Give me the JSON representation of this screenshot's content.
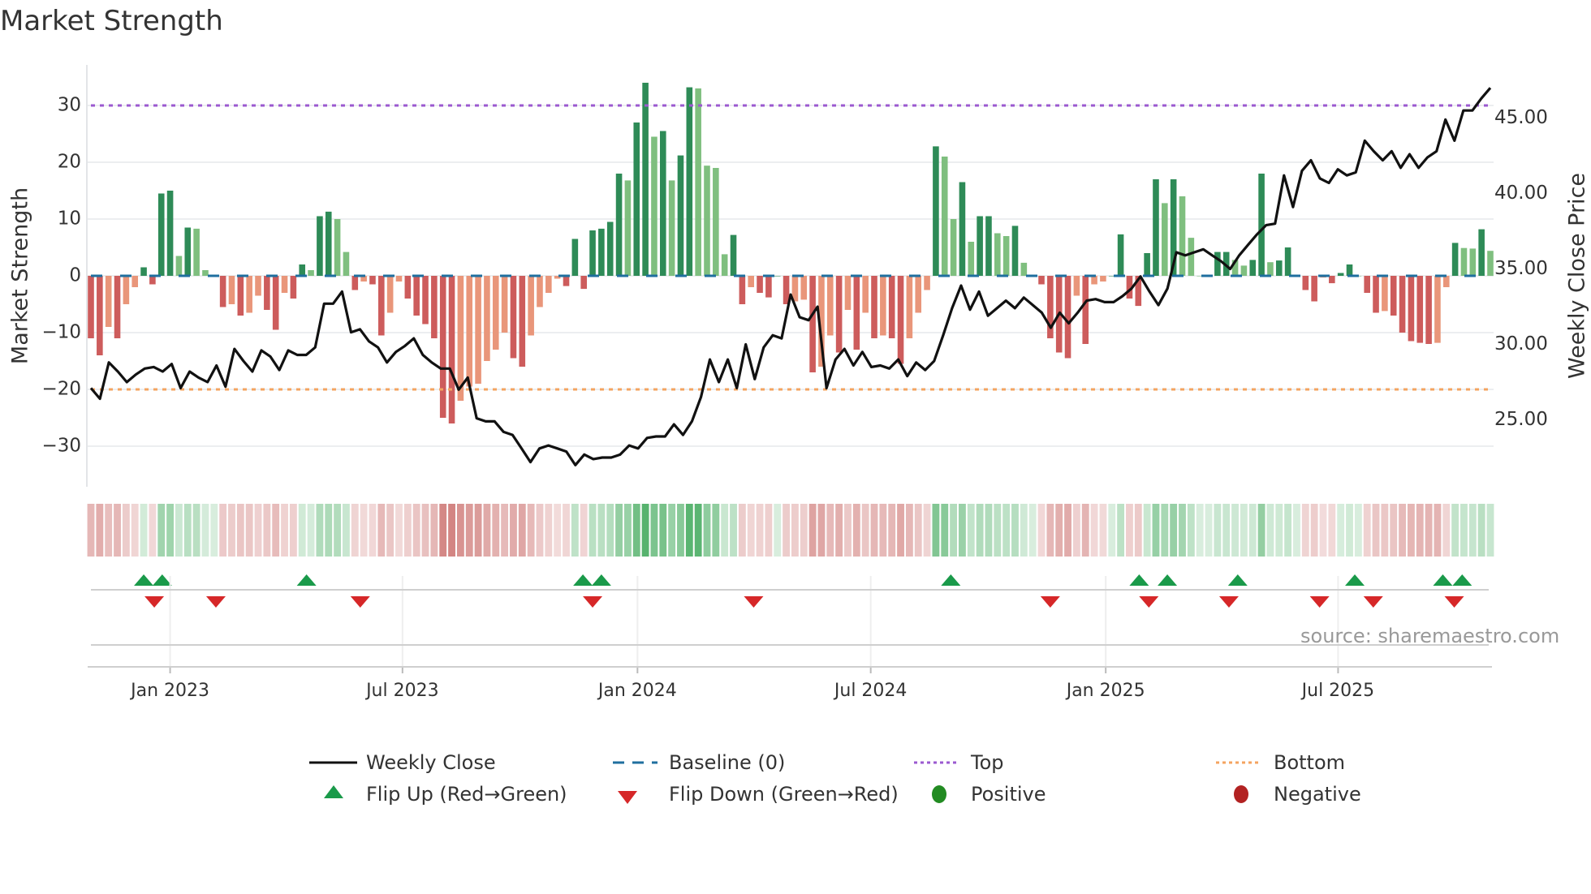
{
  "title": "Market Strength",
  "source": "source: sharemaestro.com",
  "colors": {
    "green_dark": "#2e8b57",
    "green_light": "#7fbf7f",
    "red_dark": "#cd5c5c",
    "red_light": "#e9967a",
    "heat_green": "#3aa655",
    "heat_red": "#c0504d",
    "top": "#9b59d0",
    "bottom": "#f4a460",
    "baseline": "#1f6f9f",
    "line": "#111111",
    "flip_up": "#1a9a4a",
    "flip_down": "#d62728",
    "positive": "#228b22",
    "negative": "#b22222"
  },
  "chart_data": {
    "type": "bar",
    "title": "Market Strength",
    "ylabel": "Market Strength",
    "y2label": "Weekly Close Price",
    "ylim": [
      -37,
      37
    ],
    "y2lim": [
      21,
      48
    ],
    "yticks": [
      30,
      20,
      10,
      0,
      -10,
      -20,
      -30
    ],
    "ytick_labels": [
      "30",
      "20",
      "10",
      "0",
      "−10",
      "−20",
      "−30"
    ],
    "y2ticks": [
      45,
      40,
      35,
      30,
      25
    ],
    "y2tick_labels": [
      "45.00",
      "40.00",
      "35.00",
      "30.00",
      "25.00"
    ],
    "top_level": 30,
    "bottom_level": -20,
    "xticks": [
      {
        "week": 9.0,
        "label": "Jan 2023"
      },
      {
        "week": 35.4,
        "label": "Jul 2023"
      },
      {
        "week": 62.1,
        "label": "Jan 2024"
      },
      {
        "week": 88.6,
        "label": "Jul 2024"
      },
      {
        "week": 115.3,
        "label": "Jan 2025"
      },
      {
        "week": 141.7,
        "label": "Jul 2025"
      }
    ],
    "strength": [
      -11,
      -14,
      -9,
      -11,
      -5,
      -2,
      1.5,
      -1.5,
      14.5,
      15,
      3.5,
      8.5,
      8.3,
      1,
      0,
      -5.5,
      -5,
      -7,
      -6.5,
      -3.5,
      -6,
      -9.5,
      -3,
      -4,
      2,
      1,
      10.5,
      11.3,
      10,
      4.2,
      -2.5,
      -1,
      -1.5,
      -10.5,
      -6.5,
      -1,
      -4,
      -7,
      -8.5,
      -11,
      -25,
      -26,
      -22,
      -19.5,
      -19,
      -15,
      -13,
      -10,
      -14.5,
      -16,
      -10.5,
      -5.5,
      -3,
      -0.5,
      -1.8,
      6.5,
      -2.3,
      8,
      8.3,
      9.5,
      18,
      16.8,
      27,
      34,
      24.5,
      25.5,
      16.8,
      21.2,
      33.2,
      33,
      19.4,
      19,
      3.8,
      7.2,
      -5,
      -2,
      -3,
      -3.8,
      0,
      -5,
      -4.5,
      -4.2,
      -17,
      -16,
      -10.5,
      -13.5,
      -6,
      -13,
      -6.5,
      -11,
      -10.5,
      -11,
      -15.5,
      -11,
      -6.5,
      -2.5,
      22.8,
      21,
      10,
      16.5,
      6,
      10.5,
      10.5,
      7.5,
      7,
      8.8,
      2.3,
      0,
      -1.5,
      -11,
      -13.5,
      -14.5,
      -3.5,
      -12,
      -1.5,
      -1,
      0,
      7.3,
      -4,
      -5.3,
      4,
      17,
      12.8,
      17,
      14,
      6.7,
      0,
      0,
      4.2,
      4.2,
      2.8,
      1.8,
      2.8,
      18,
      2.4,
      2.7,
      5,
      0,
      -2.5,
      -4.5,
      -0.3,
      -1.3,
      0.5,
      2,
      0,
      -3,
      -6.5,
      -6.2,
      -7,
      -10,
      -11.5,
      -11.8,
      -12,
      -11.8,
      -2,
      5.8,
      4.9,
      4.8,
      8.2,
      4.4
    ],
    "weekly_close": [
      27.1,
      26.4,
      28.8,
      28.2,
      27.5,
      28.0,
      28.4,
      28.5,
      28.2,
      28.7,
      27.1,
      28.2,
      27.8,
      27.5,
      28.6,
      27.2,
      29.7,
      28.9,
      28.2,
      29.6,
      29.2,
      28.3,
      29.6,
      29.3,
      29.3,
      29.8,
      32.7,
      32.7,
      33.5,
      30.8,
      31.0,
      30.2,
      29.8,
      28.8,
      29.5,
      29.9,
      30.4,
      29.3,
      28.8,
      28.4,
      28.4,
      27.0,
      27.8,
      25.1,
      24.9,
      24.9,
      24.2,
      24.0,
      23.1,
      22.2,
      23.1,
      23.3,
      23.1,
      22.9,
      22.0,
      22.7,
      22.4,
      22.5,
      22.5,
      22.7,
      23.3,
      23.1,
      23.8,
      23.9,
      23.9,
      24.7,
      24.0,
      24.9,
      26.5,
      29.0,
      27.5,
      29.0,
      27.1,
      30.0,
      27.7,
      29.8,
      30.6,
      30.4,
      33.3,
      31.8,
      31.6,
      32.5,
      27.1,
      29.0,
      29.7,
      28.6,
      29.5,
      28.5,
      28.6,
      28.4,
      29.0,
      27.9,
      28.8,
      28.3,
      28.9,
      30.6,
      32.4,
      33.9,
      32.3,
      33.5,
      31.9,
      32.4,
      32.9,
      32.4,
      33.1,
      32.6,
      32.1,
      31.1,
      32.1,
      31.4,
      32.1,
      32.9,
      33.0,
      32.8,
      32.8,
      33.2,
      33.7,
      34.5,
      33.5,
      32.6,
      33.7,
      36.1,
      35.9,
      36.1,
      36.3,
      35.9,
      35.5,
      35.0,
      35.9,
      36.6,
      37.3,
      37.9,
      38.0,
      41.2,
      39.1,
      41.5,
      42.2,
      41.0,
      40.7,
      41.6,
      41.2,
      41.4,
      43.5,
      42.8,
      42.2,
      42.8,
      41.7,
      42.6,
      41.7,
      42.4,
      42.8,
      44.9,
      43.5,
      45.5,
      45.5,
      46.3,
      47.0
    ],
    "flip_up_weeks": [
      6.0,
      8.1,
      24.5,
      55.9,
      58,
      97.7,
      119.1,
      122.3,
      130.3,
      143.6,
      153.6,
      155.8
    ],
    "flip_down_weeks": [
      7.2,
      14.2,
      30.6,
      57,
      75.3,
      109,
      120.2,
      129.3,
      139.6,
      145.7,
      154.9
    ],
    "legend": {
      "weekly_close": "Weekly Close",
      "baseline": "Baseline (0)",
      "top": "Top",
      "bottom": "Bottom",
      "flip_up": "Flip Up (Red→Green)",
      "flip_down": "Flip Down (Green→Red)",
      "positive": "Positive",
      "negative": "Negative"
    }
  }
}
